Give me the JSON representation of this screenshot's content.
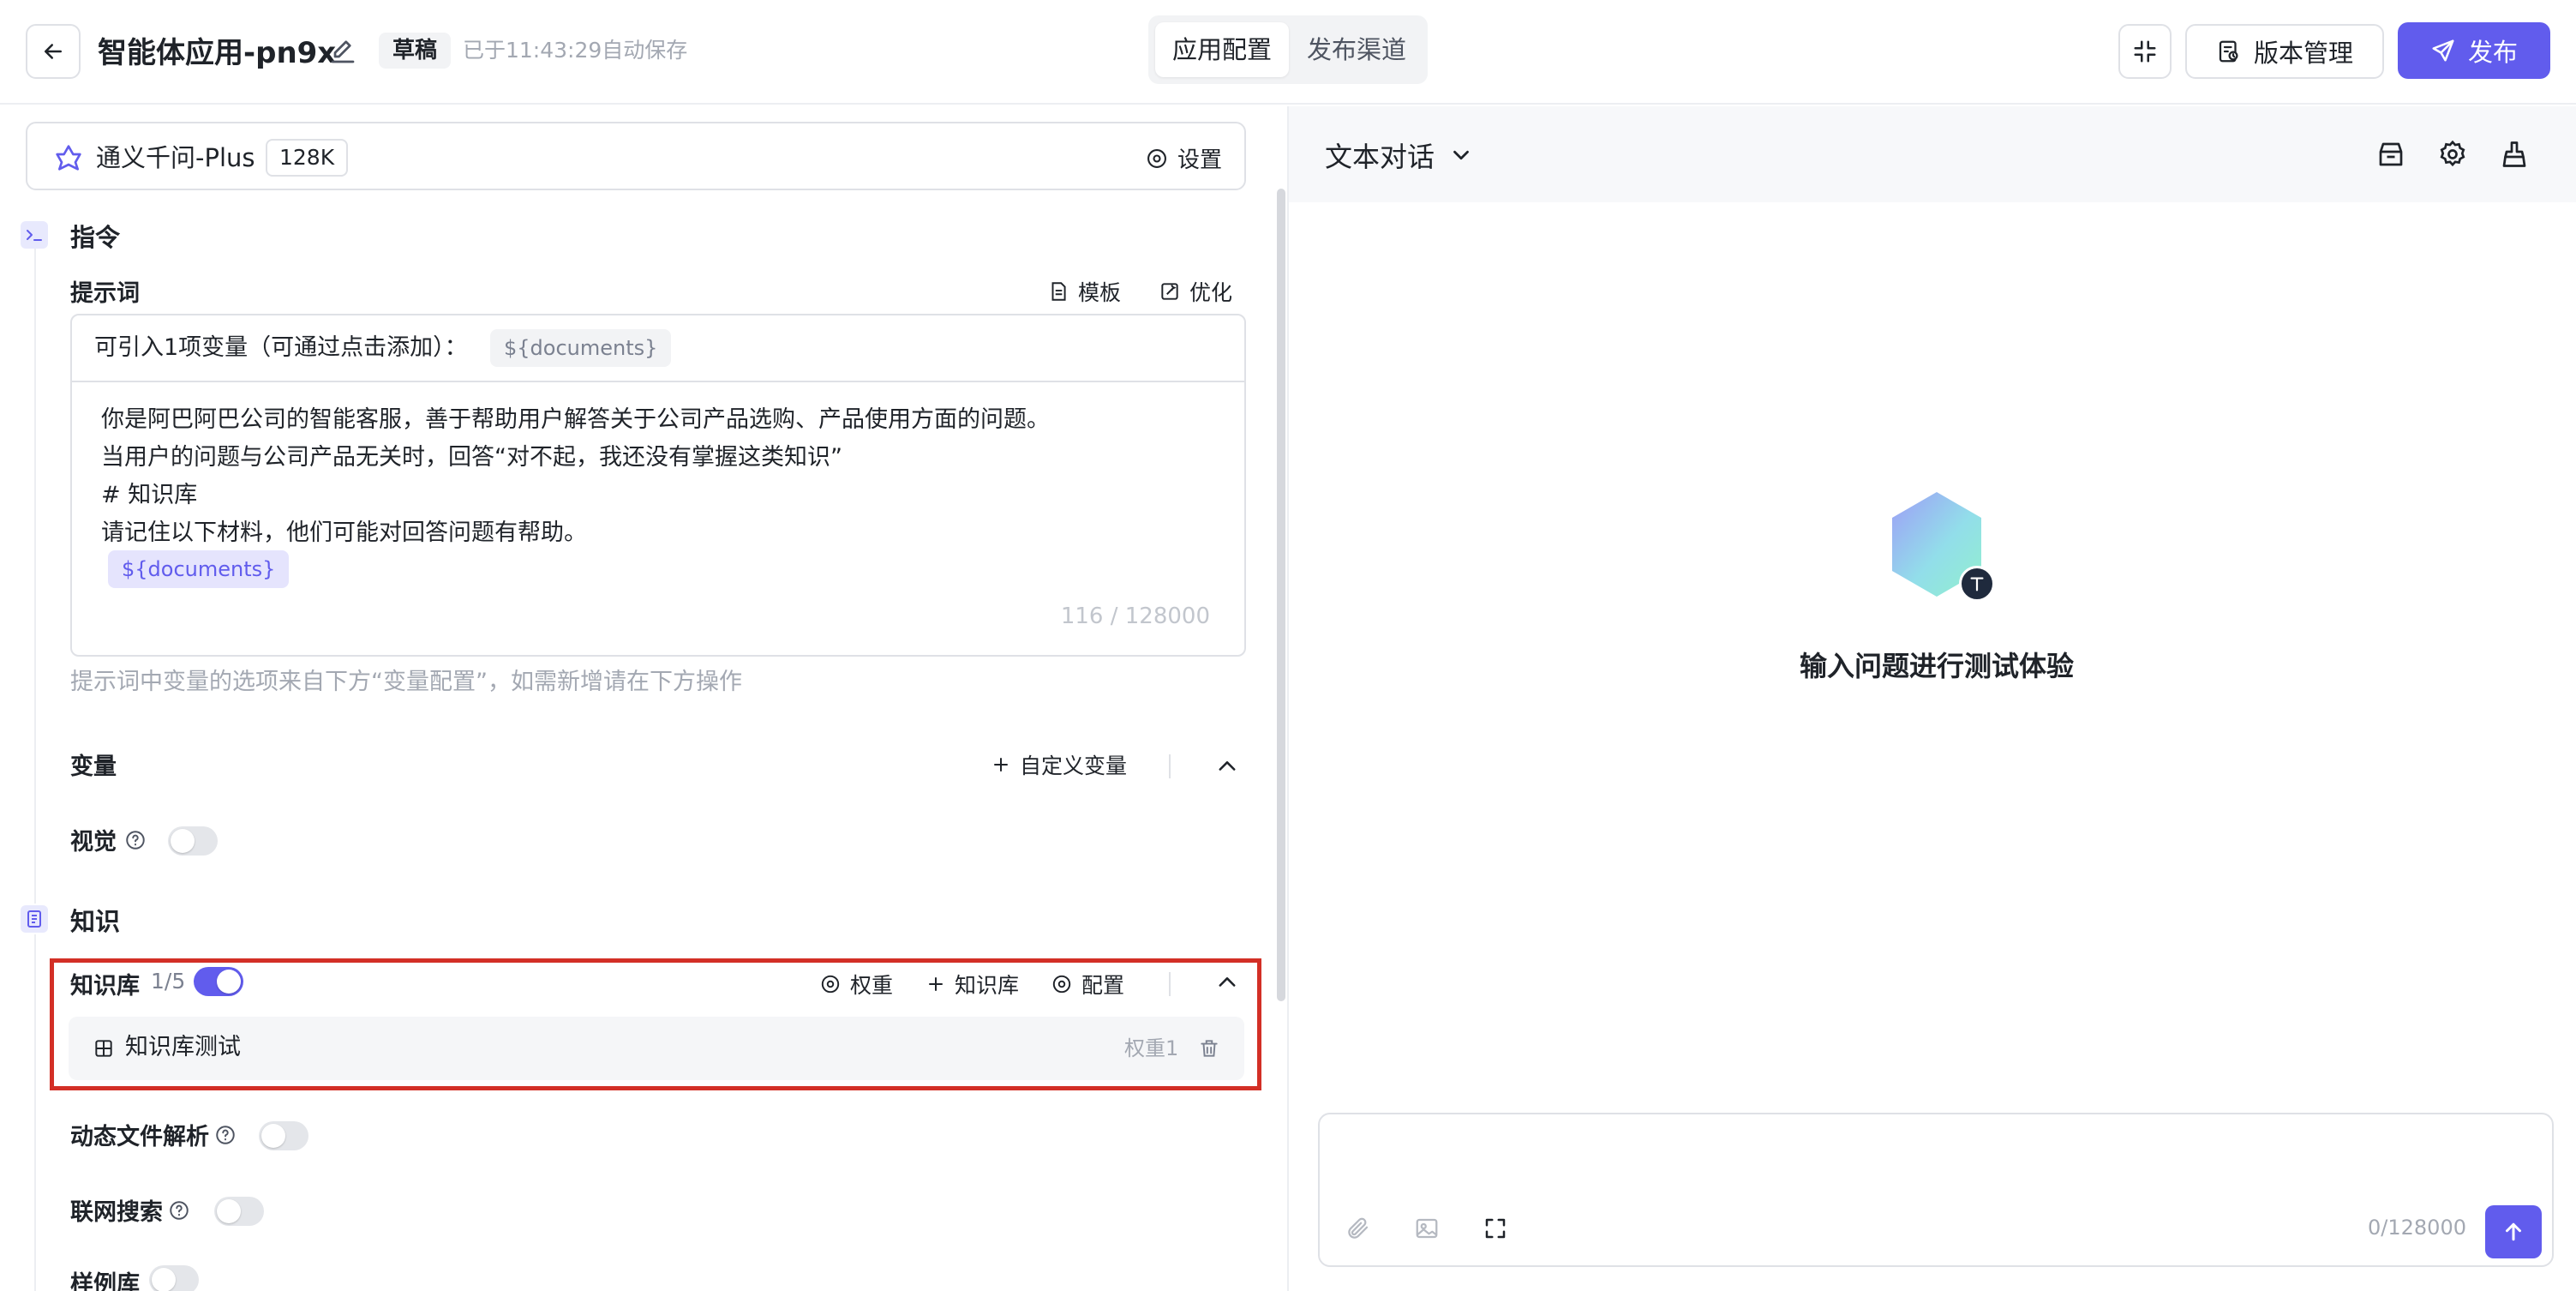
{
  "header": {
    "app_title": "智能体应用-pn9x",
    "draft_badge": "草稿",
    "autosave_text": "已于11:43:29自动保存",
    "tabs": [
      {
        "label": "应用配置",
        "active": true
      },
      {
        "label": "发布渠道",
        "active": false
      }
    ],
    "version_label": "版本管理",
    "publish_label": "发布"
  },
  "model": {
    "name": "通义千问-Plus",
    "context_badge": "128K",
    "settings_label": "设置"
  },
  "instruction": {
    "section_title": "指令",
    "prompt_label": "提示词",
    "template_label": "模板",
    "optimize_label": "优化",
    "variable_hint": "可引入1项变量（可通过点击添加）：",
    "variable_chip": "${documents}",
    "prompt_lines": [
      "你是阿巴阿巴公司的智能客服，善于帮助用户解答关于公司产品选购、产品使用方面的问题。",
      "当用户的问题与公司产品无关时，回答“对不起，我还没有掌握这类知识”",
      "# 知识库",
      "请记住以下材料，他们可能对回答问题有帮助。"
    ],
    "prompt_variable_token": "${documents}",
    "char_count": "116 / 128000",
    "help_text": "提示词中变量的选项来自下方“变量配置”，如需新增请在下方操作",
    "variables_label": "变量",
    "custom_variable_label": "自定义变量",
    "vision_label": "视觉",
    "vision_enabled": false
  },
  "knowledge": {
    "section_title": "知识",
    "kb_label": "知识库",
    "kb_count": "1/5",
    "kb_enabled": true,
    "weight_label": "权重",
    "add_kb_label": "知识库",
    "config_label": "配置",
    "items": [
      {
        "name": "知识库测试",
        "weight": "权重1"
      }
    ],
    "dynamic_file_label": "动态文件解析",
    "dynamic_file_enabled": false,
    "web_search_label": "联网搜索",
    "web_search_enabled": false,
    "sample_lib_label": "样例库",
    "sample_lib_enabled": false
  },
  "chat": {
    "mode_label": "文本对话",
    "empty_title": "输入问题进行测试体验",
    "input_placeholder": "",
    "input_count": "0/128000"
  },
  "colors": {
    "accent": "#615ced",
    "highlight_border": "#d32f26"
  }
}
